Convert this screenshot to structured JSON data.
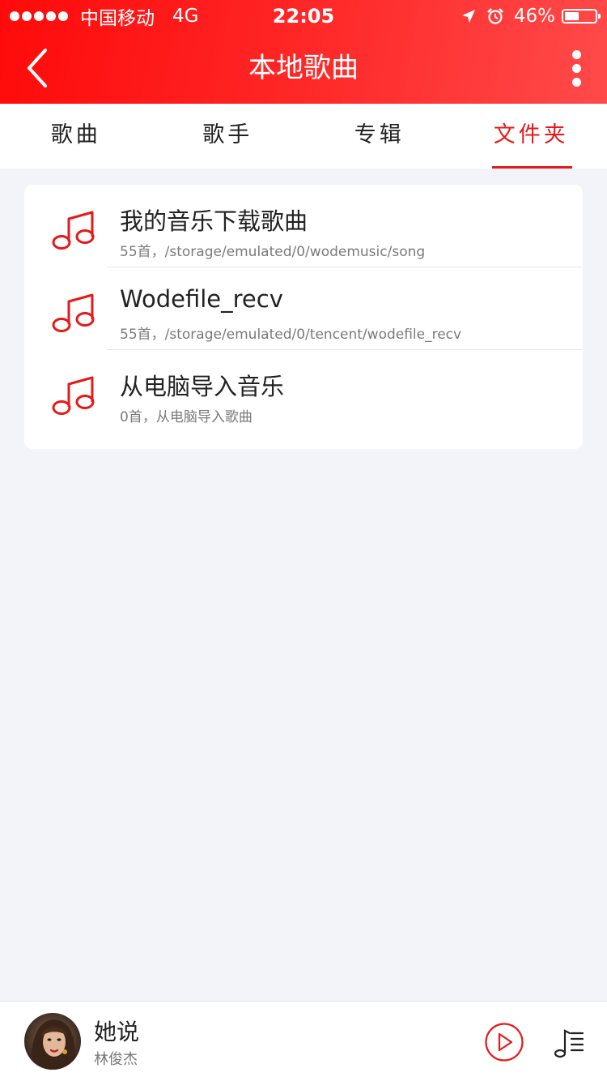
{
  "status_bar": {
    "carrier": "中国移动",
    "network": "4G",
    "time": "22:05",
    "battery": "46%",
    "battery_level": 0.46,
    "icons": [
      "signal-dots-icon",
      "location-arrow-icon",
      "alarm-icon",
      "battery-icon"
    ]
  },
  "header": {
    "title": "本地歌曲",
    "back_icon": "chevron-left-icon",
    "more_icon": "more-vertical-icon"
  },
  "tabs": [
    {
      "label": "歌曲",
      "active": false
    },
    {
      "label": "歌手",
      "active": false
    },
    {
      "label": "专辑",
      "active": false
    },
    {
      "label": "文件夹",
      "active": true
    }
  ],
  "folders": [
    {
      "name": "我的音乐下载歌曲",
      "info": "55首，/storage/emulated/0/wodemusic/song",
      "icon": "music-note-icon"
    },
    {
      "name": "Wodefile_recv",
      "info": "55首，/storage/emulated/0/tencent/wodefile_recv",
      "icon": "music-note-icon"
    },
    {
      "name": "从电脑导入音乐",
      "info": "0首，从电脑导入歌曲",
      "icon": "music-note-icon"
    }
  ],
  "player": {
    "song_title": "她说",
    "artist": "林俊杰",
    "play_icon": "play-circle-icon",
    "playlist_icon": "playlist-icon"
  },
  "colors": {
    "accent": "#e61919",
    "header_gradient_start": "#ff0a0a",
    "header_gradient_end": "#ff4a4a",
    "background": "#f3f4f9"
  }
}
